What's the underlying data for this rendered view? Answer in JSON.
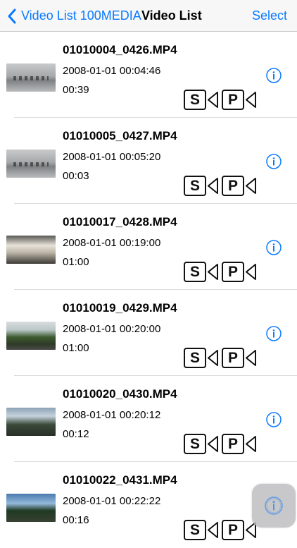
{
  "navbar": {
    "back_label": "Video List 100MEDIA",
    "title": "Video List",
    "select_label": "Select",
    "accent_color": "#0a7aff"
  },
  "videos": [
    {
      "filename": "01010004_0426.MP4",
      "datetime": "2008-01-01 00:04:46",
      "duration": "00:39",
      "badge_s": "S",
      "badge_p": "P"
    },
    {
      "filename": "01010005_0427.MP4",
      "datetime": "2008-01-01 00:05:20",
      "duration": "00:03",
      "badge_s": "S",
      "badge_p": "P"
    },
    {
      "filename": "01010017_0428.MP4",
      "datetime": "2008-01-01 00:19:00",
      "duration": "01:00",
      "badge_s": "S",
      "badge_p": "P"
    },
    {
      "filename": "01010019_0429.MP4",
      "datetime": "2008-01-01 00:20:00",
      "duration": "01:00",
      "badge_s": "S",
      "badge_p": "P"
    },
    {
      "filename": "01010020_0430.MP4",
      "datetime": "2008-01-01 00:20:12",
      "duration": "00:12",
      "badge_s": "S",
      "badge_p": "P"
    },
    {
      "filename": "01010022_0431.MP4",
      "datetime": "2008-01-01 00:22:22",
      "duration": "00:16",
      "badge_s": "S",
      "badge_p": "P"
    }
  ],
  "icons": {
    "back": "chevron-left-icon",
    "info": "info-circle-icon",
    "camera": "video-camera-icon",
    "floating": "assistive-touch-icon"
  }
}
